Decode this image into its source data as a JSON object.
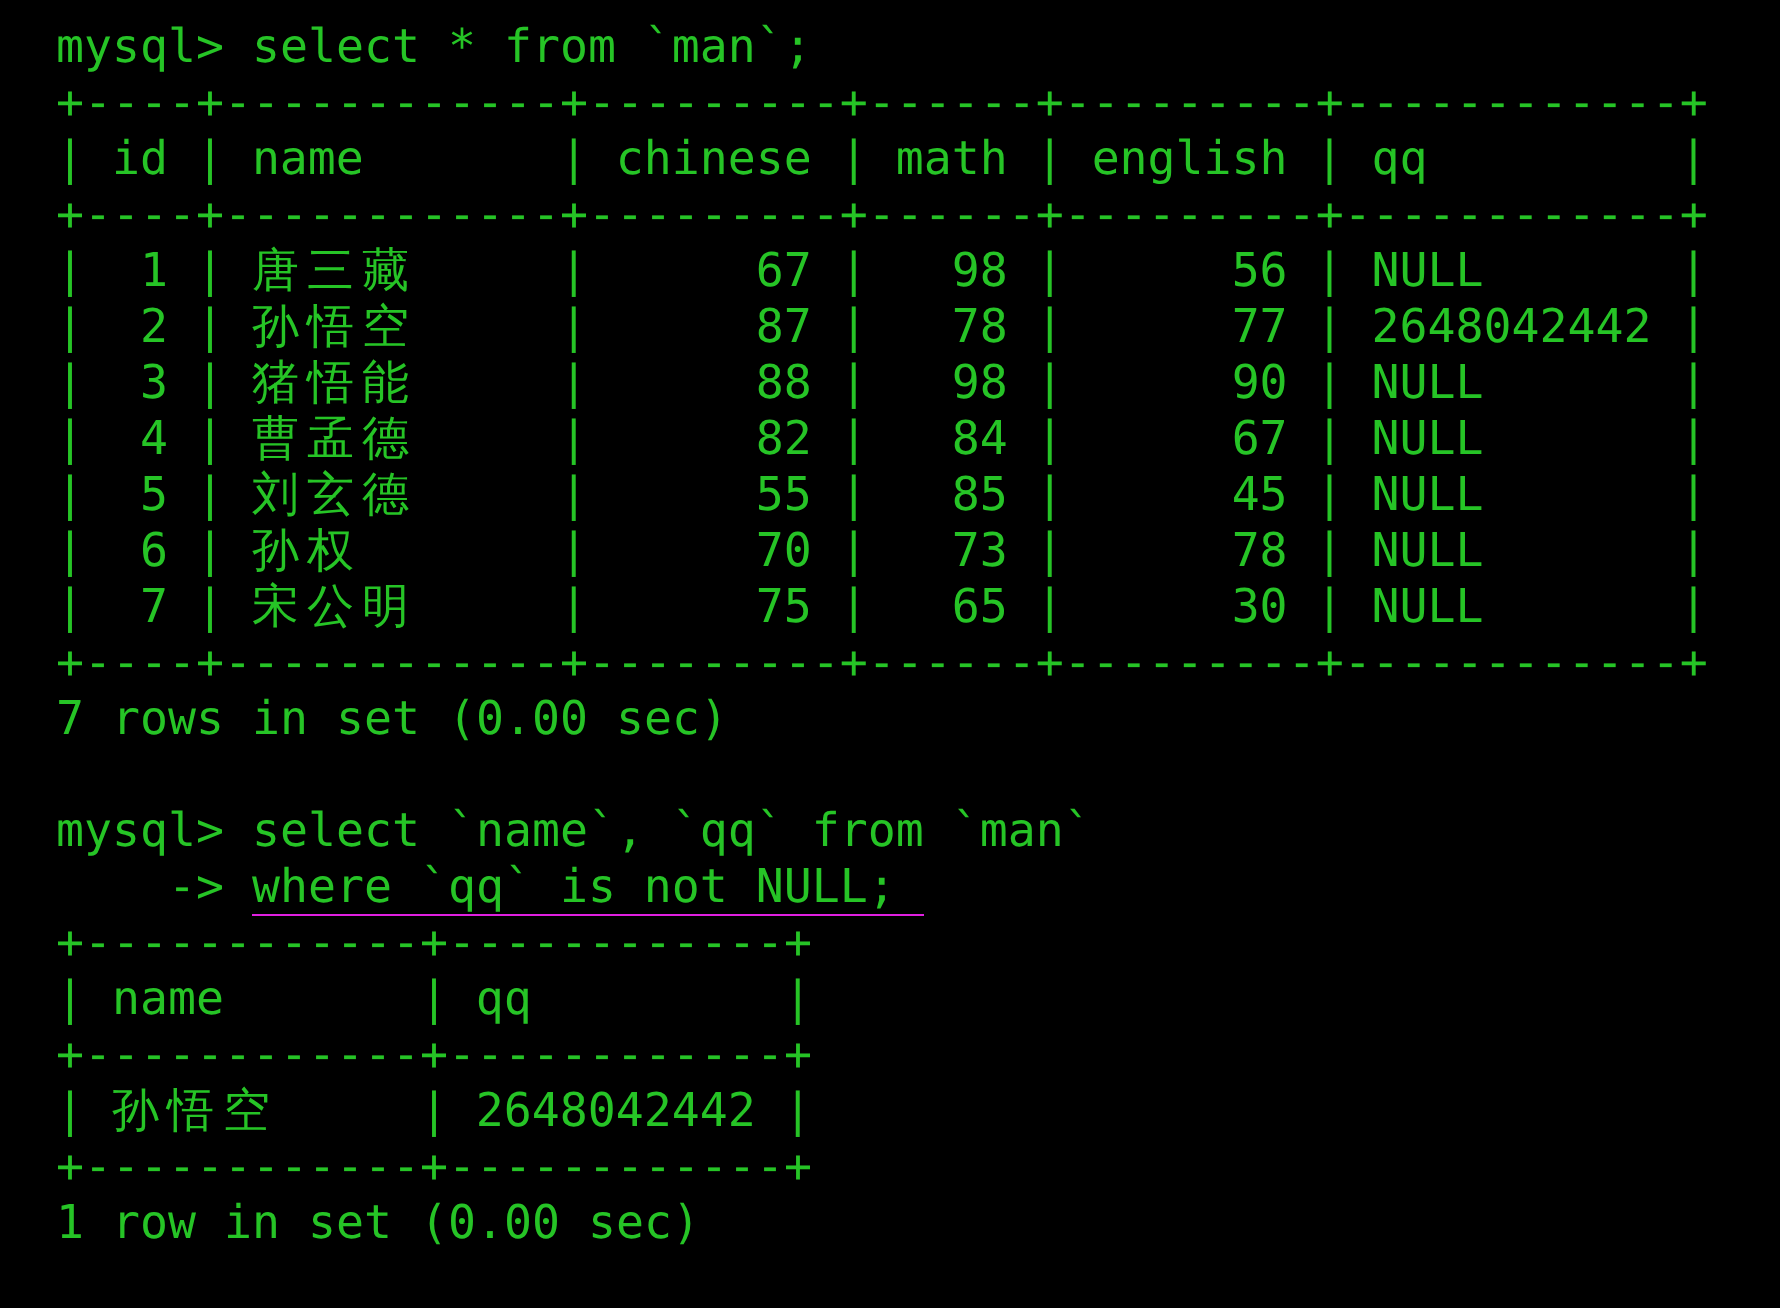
{
  "terminal": {
    "blocks": [
      {
        "kind": "prompt",
        "prompt": "mysql>",
        "command": "select * from `man`;",
        "underlined": false
      },
      {
        "kind": "table",
        "border": "+----+------------+---------+------+---------+------------+",
        "separator": "|",
        "columns": [
          {
            "label": "id",
            "kind": "number"
          },
          {
            "label": "name",
            "kind": "text"
          },
          {
            "label": "chinese",
            "kind": "number"
          },
          {
            "label": "math",
            "kind": "number"
          },
          {
            "label": "english",
            "kind": "number"
          },
          {
            "label": "qq",
            "kind": "text"
          }
        ],
        "rows": [
          [
            "1",
            "唐三藏",
            "67",
            "98",
            "56",
            "NULL"
          ],
          [
            "2",
            "孙悟空",
            "87",
            "78",
            "77",
            "2648042442"
          ],
          [
            "3",
            "猪悟能",
            "88",
            "98",
            "90",
            "NULL"
          ],
          [
            "4",
            "曹孟德",
            "82",
            "84",
            "67",
            "NULL"
          ],
          [
            "5",
            "刘玄德",
            "55",
            "85",
            "45",
            "NULL"
          ],
          [
            "6",
            "孙权",
            "70",
            "73",
            "78",
            "NULL"
          ],
          [
            "7",
            "宋公明",
            "75",
            "65",
            "30",
            "NULL"
          ]
        ]
      },
      {
        "kind": "status",
        "text": "7 rows in set (0.00 sec)"
      },
      {
        "kind": "prompt",
        "prompt": "mysql>",
        "command": "select `name`, `qq` from `man`",
        "underlined": false
      },
      {
        "kind": "prompt",
        "prompt": "->",
        "command": "where `qq` is not NULL;",
        "underlined": true
      },
      {
        "kind": "table",
        "border": "+------------+------------+",
        "separator": "|",
        "columns": [
          {
            "label": "name",
            "kind": "text"
          },
          {
            "label": "qq",
            "kind": "text"
          }
        ],
        "rows": [
          [
            "孙悟空",
            "2648042442"
          ]
        ]
      },
      {
        "kind": "status",
        "text": "1 row in set (0.00 sec)"
      }
    ]
  }
}
